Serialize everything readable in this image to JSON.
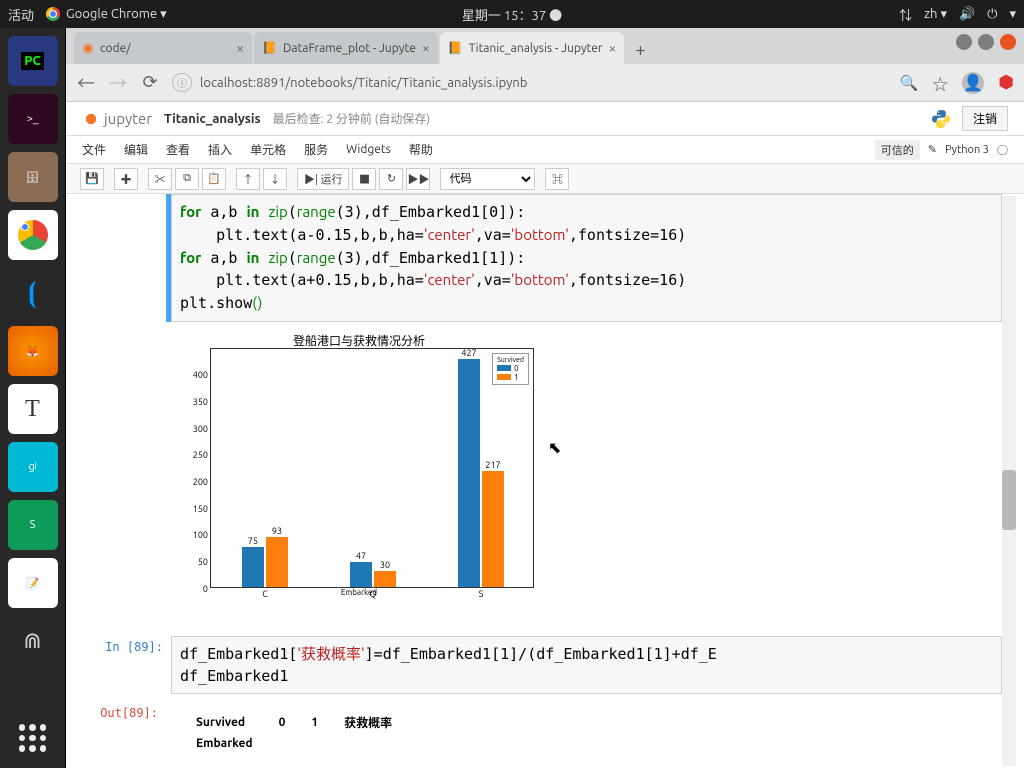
{
  "topbar": {
    "activities": "活动",
    "app": "Google Chrome ▾",
    "clock": "星期一 15：37 ●"
  },
  "tabs": [
    {
      "title": "code/",
      "active": false
    },
    {
      "title": "DataFrame_plot - Jupyte",
      "active": false
    },
    {
      "title": "Titanic_analysis - Jupyter",
      "active": true
    }
  ],
  "url": "localhost:8891/notebooks/Titanic/Titanic_analysis.ipynb",
  "jupyter": {
    "brand": "jupyter",
    "nbname": "Titanic_analysis",
    "checkpoint": "最后检查: 2 分钟前",
    "autosave": "(自动保存)",
    "logout": "注销",
    "menu": [
      "文件",
      "编辑",
      "查看",
      "插入",
      "单元格",
      "服务",
      "Widgets",
      "帮助"
    ],
    "trusted": "可信的",
    "kernel": "Python 3",
    "toolbar": {
      "run": "▶| 运行",
      "celltype": "代码"
    }
  },
  "code1": "for a,b in zip(range(3),df_Embarked1[0]):\n    plt.text(a-0.15,b,b,ha='center',va='bottom',fontsize=16)\nfor a,b in zip(range(3),df_Embarked1[1]):\n    plt.text(a+0.15,b,b,ha='center',va='bottom',fontsize=16)\nplt.show()",
  "chart_data": {
    "type": "bar",
    "title": "登船港口与获救情况分析",
    "xlabel": "Embarked",
    "categories": [
      "C",
      "Q",
      "S"
    ],
    "series": [
      {
        "name": "0",
        "values": [
          75,
          47,
          427
        ],
        "color": "#1f77b4"
      },
      {
        "name": "1",
        "values": [
          93,
          30,
          217
        ],
        "color": "#ff7f0e"
      }
    ],
    "legend_title": "Survived",
    "ylim": [
      0,
      450
    ],
    "yticks": [
      0,
      50,
      100,
      150,
      200,
      250,
      300,
      350,
      400
    ]
  },
  "code2_prompt": "In [89]:",
  "code2": "df_Embarked1['获救概率']=df_Embarked1[1]/(df_Embarked1[1]+df_E\ndf_Embarked1",
  "out2_prompt": "Out[89]:",
  "table_headers": [
    "Survived",
    "0",
    "1",
    "获救概率"
  ],
  "table_index_name": "Embarked"
}
